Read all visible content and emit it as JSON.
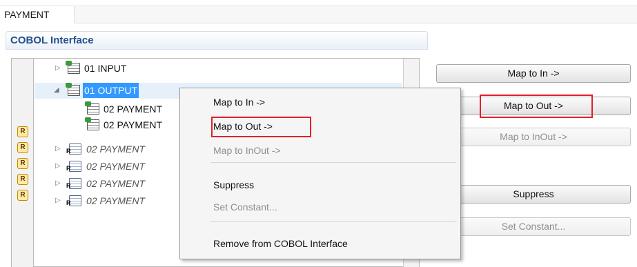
{
  "tab": {
    "label": "PAYMENT"
  },
  "section": {
    "title": "COBOL Interface"
  },
  "tree": {
    "items": [
      {
        "label": "01 INPUT",
        "expanded": false,
        "icon": "structure-icon",
        "mapped": false
      },
      {
        "label": "01 OUTPUT",
        "expanded": true,
        "selected": true,
        "icon": "structure-icon",
        "mapped": false
      },
      {
        "label": "02 PAYMENT",
        "icon": "structure-icon",
        "mapped": false
      },
      {
        "label": "02 PAYMENT",
        "icon": "structure-redefine-icon",
        "mapped": true
      },
      {
        "label": "02 PAYMENT",
        "icon": "field-redefine-icon",
        "italic": true,
        "mapped": true
      },
      {
        "label": "02 PAYMENT",
        "icon": "field-redefine-icon",
        "italic": true,
        "mapped": true
      },
      {
        "label": "02 PAYMENT",
        "icon": "field-redefine-icon",
        "italic": true,
        "mapped": true
      },
      {
        "label": "02 PAYMENT",
        "icon": "field-redefine-icon",
        "italic": true,
        "mapped": true
      }
    ]
  },
  "buttons": {
    "map_in": "Map to In ->",
    "map_out": "Map to Out ->",
    "map_inout": "Map to InOut ->",
    "suppress": "Suppress",
    "set_constant": "Set Constant..."
  },
  "context_menu": {
    "items": [
      {
        "label": "Map to In ->",
        "enabled": true
      },
      {
        "label": "Map to Out ->",
        "enabled": true,
        "highlighted": true
      },
      {
        "label": "Map to InOut ->",
        "enabled": false
      },
      {
        "label": "Suppress",
        "enabled": true
      },
      {
        "label": "Set Constant...",
        "enabled": false
      },
      {
        "label": "Remove from COBOL Interface",
        "enabled": true
      }
    ]
  },
  "colors": {
    "header_text": "#23508c",
    "selection": "#3399ff",
    "highlight_box": "#e0202a"
  },
  "gutter_icon_glyph": "R"
}
